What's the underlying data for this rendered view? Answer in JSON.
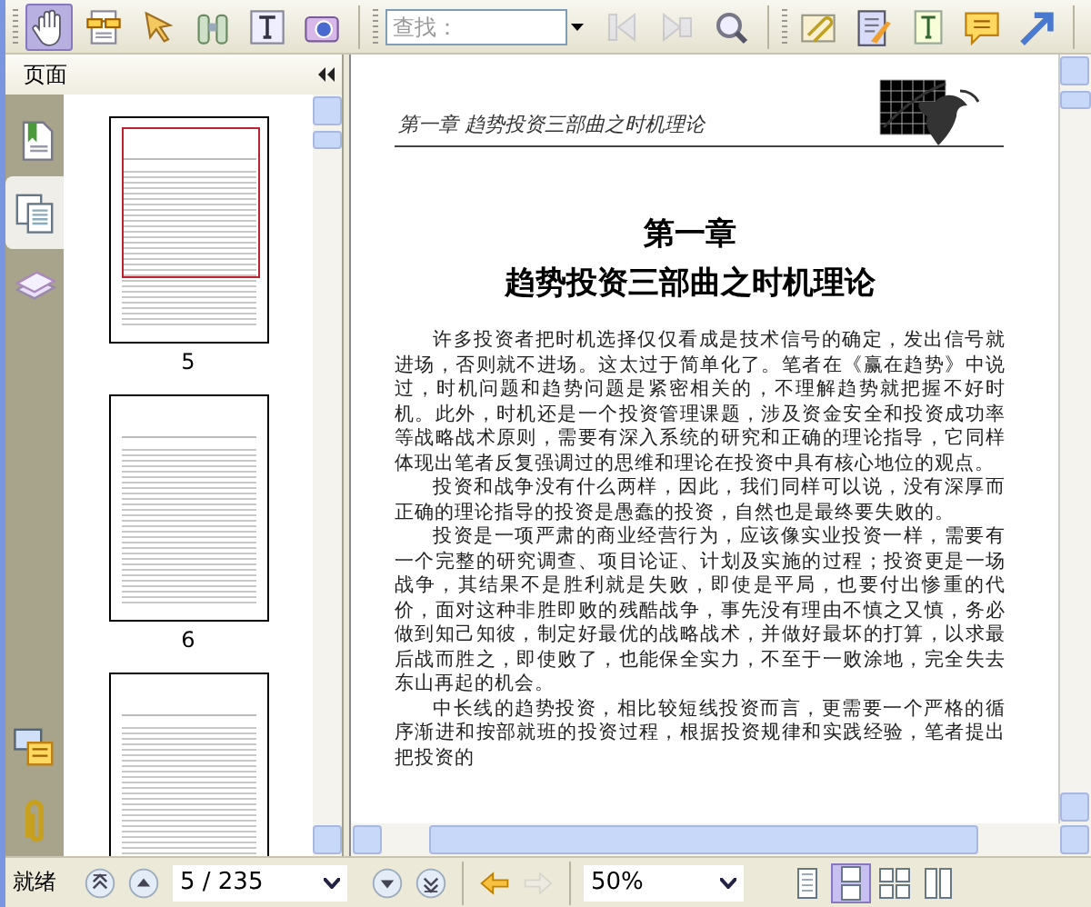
{
  "toolbar": {
    "tools": [
      {
        "selected": true
      },
      {
        "selected": false
      },
      {
        "selected": false
      },
      {
        "selected": false
      },
      {
        "selected": false
      },
      {
        "selected": false
      }
    ],
    "search": {
      "placeholder": "查找："
    },
    "search_buttons": [
      {
        "disabled": true
      },
      {
        "disabled": true
      },
      {
        "disabled": false
      }
    ],
    "annotation_tools": [
      {
        "selected": false
      },
      {
        "selected": false
      },
      {
        "selected": false
      },
      {
        "selected": false
      },
      {
        "selected": false
      }
    ]
  },
  "side_panel": {
    "title": "页面",
    "tabs": [
      {
        "selected": false
      },
      {
        "selected": true
      },
      {
        "selected": false
      },
      {
        "selected": false
      },
      {
        "selected": false
      }
    ],
    "thumbnails": [
      {
        "label": "5",
        "selected": true
      },
      {
        "label": "6",
        "selected": false
      },
      {
        "selected": false
      }
    ]
  },
  "document": {
    "running_head": "第一章  趋势投资三部曲之时机理论",
    "chapter": "第一章",
    "chapter_title": "趋势投资三部曲之时机理论",
    "paragraphs": [
      "许多投资者把时机选择仅仅看成是技术信号的确定，发出信号就进场，否则就不进场。这太过于简单化了。笔者在《赢在趋势》中说过，时机问题和趋势问题是紧密相关的，不理解趋势就把握不好时机。此外，时机还是一个投资管理课题，涉及资金安全和投资成功率等战略战术原则，需要有深入系统的研究和正确的理论指导，它同样体现出笔者反复强调过的思维和理论在投资中具有核心地位的观点。",
      "投资和战争没有什么两样，因此，我们同样可以说，没有深厚而正确的理论指导的投资是愚蠢的投资，自然也是最终要失败的。",
      "投资是一项严肃的商业经营行为，应该像实业投资一样，需要有一个完整的研究调查、项目论证、计划及实施的过程；投资更是一场战争，其结果不是胜利就是失败，即使是平局，也要付出惨重的代价，面对这种非胜即败的残酷战争，事先没有理由不慎之又慎，务必做到知己知彼，制定好最优的战略战术，并做好最坏的打算，以求最后战而胜之，即使败了，也能保全实力，不至于一败涂地，完全失去东山再起的机会。",
      "中长线的趋势投资，相比较短线投资而言，更需要一个严格的循序渐进和按部就班的投资过程，根据投资规律和实践经验，笔者提出把投资的"
    ]
  },
  "status_bar": {
    "status": "就绪",
    "nav_buttons": [
      {
        "disabled": false
      },
      {
        "disabled": false
      },
      {
        "disabled": false
      },
      {
        "disabled": false
      }
    ],
    "page": "5 / 235",
    "history": [
      {
        "disabled": false
      },
      {
        "disabled": true
      }
    ],
    "zoom": "50%",
    "view_modes": [
      {
        "selected": false
      },
      {
        "selected": true
      },
      {
        "selected": false
      },
      {
        "selected": false
      }
    ]
  }
}
